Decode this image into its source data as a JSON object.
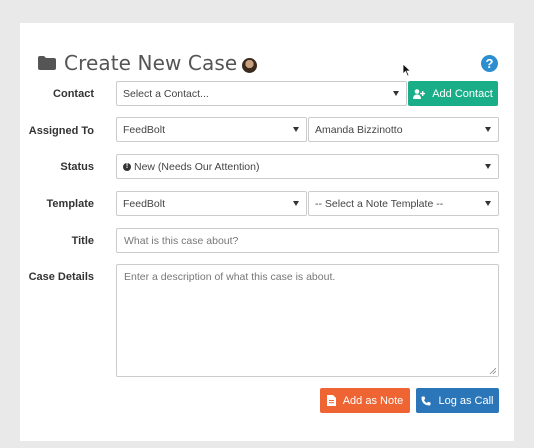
{
  "header": {
    "title": "Create New Case"
  },
  "fields": {
    "contact": {
      "label": "Contact",
      "value": "Select a Contact...",
      "button": "Add Contact"
    },
    "assigned_to": {
      "label": "Assigned To",
      "team": "FeedBolt",
      "user": "Amanda Bizzinotto"
    },
    "status": {
      "label": "Status",
      "value": "New (Needs Our Attention)"
    },
    "template": {
      "label": "Template",
      "company": "FeedBolt",
      "note_template": "-- Select a Note Template --"
    },
    "title": {
      "label": "Title",
      "placeholder": "What is this case about?"
    },
    "case_details": {
      "label": "Case Details",
      "placeholder": "Enter a description of what this case is about."
    }
  },
  "actions": {
    "add_note": "Add as Note",
    "log_call": "Log as Call"
  },
  "icons": {
    "folder": "folder-icon",
    "help": "question-circle-icon",
    "add_contact": "user-plus-icon",
    "status": "exclamation-circle-icon",
    "note": "file-icon",
    "call": "phone-icon"
  },
  "colors": {
    "green": "#1aae88",
    "orange": "#ef6433",
    "blue": "#2b76b8",
    "help": "#2d8ecf"
  }
}
